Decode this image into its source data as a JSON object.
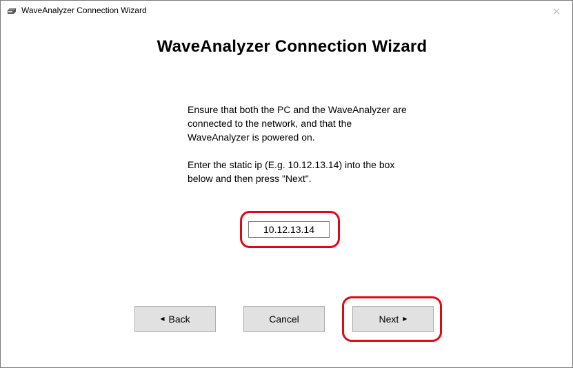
{
  "window": {
    "title": "WaveAnalyzer Connection Wizard",
    "close_glyph": "✕"
  },
  "heading": "WaveAnalyzer Connection Wizard",
  "instructions": {
    "paragraph1": "Ensure that both the PC and the WaveAnalyzer are connected to the network, and that the WaveAnalyzer is powered on.",
    "paragraph2": "Enter the static ip (E.g. 10.12.13.14) into the box below and then press \"Next\"."
  },
  "ip_field": {
    "value": "10.12.13.14"
  },
  "buttons": {
    "back_label": "Back",
    "back_arrow": "◀",
    "cancel_label": "Cancel",
    "next_label": "Next",
    "next_arrow": "▶"
  },
  "icons": {
    "app_icon": "waveanalyzer-device-icon",
    "close": "close-icon"
  },
  "colors": {
    "highlight": "#e30613",
    "button_bg": "#e1e1e1",
    "button_border": "#adadad"
  }
}
